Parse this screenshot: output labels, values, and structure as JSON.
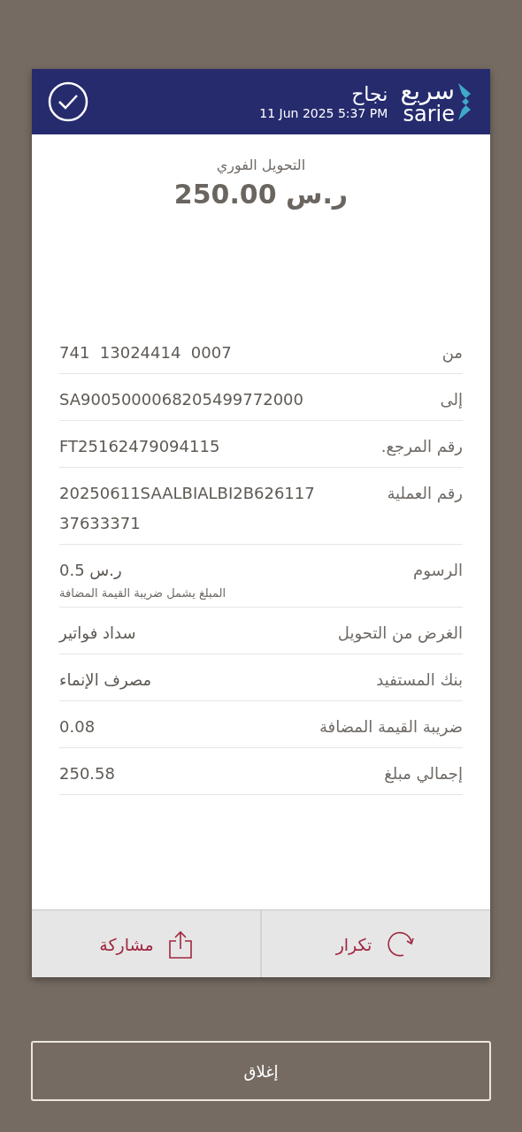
{
  "header": {
    "logo_arabic": "سريع",
    "logo_latin": "sarie",
    "status": "نجاح",
    "datetime": "11 Jun 2025 5:37 PM"
  },
  "transfer": {
    "type": "التحويل الفوري",
    "amount": "250.00 ر.س"
  },
  "details": [
    {
      "label": "من",
      "value": "741  13024414  0007"
    },
    {
      "label": "إلى",
      "value": "SA9005000068205499772000"
    },
    {
      "label": "رقم المرجع.",
      "value": "FT25162479094115"
    },
    {
      "label": "رقم العملية",
      "value": "20250611SAALBIALBI2B62611737633371"
    },
    {
      "label": "الرسوم",
      "value": "0.5 ر.س",
      "note": "المبلغ يشمل ضريبة القيمة المضافة"
    },
    {
      "label": "الغرض من التحويل",
      "value": "سداد فواتير"
    },
    {
      "label": "بنك المستفيد",
      "value": "مصرف الإنماء"
    },
    {
      "label": "ضريبة القيمة المضافة",
      "value": "0.08"
    },
    {
      "label": "إجمالي مبلغ",
      "value": "250.58"
    }
  ],
  "actions": [
    {
      "kind": "repeat",
      "label": "تكرار"
    },
    {
      "kind": "share",
      "label": "مشاركة"
    }
  ],
  "close_button": "إغلاق"
}
